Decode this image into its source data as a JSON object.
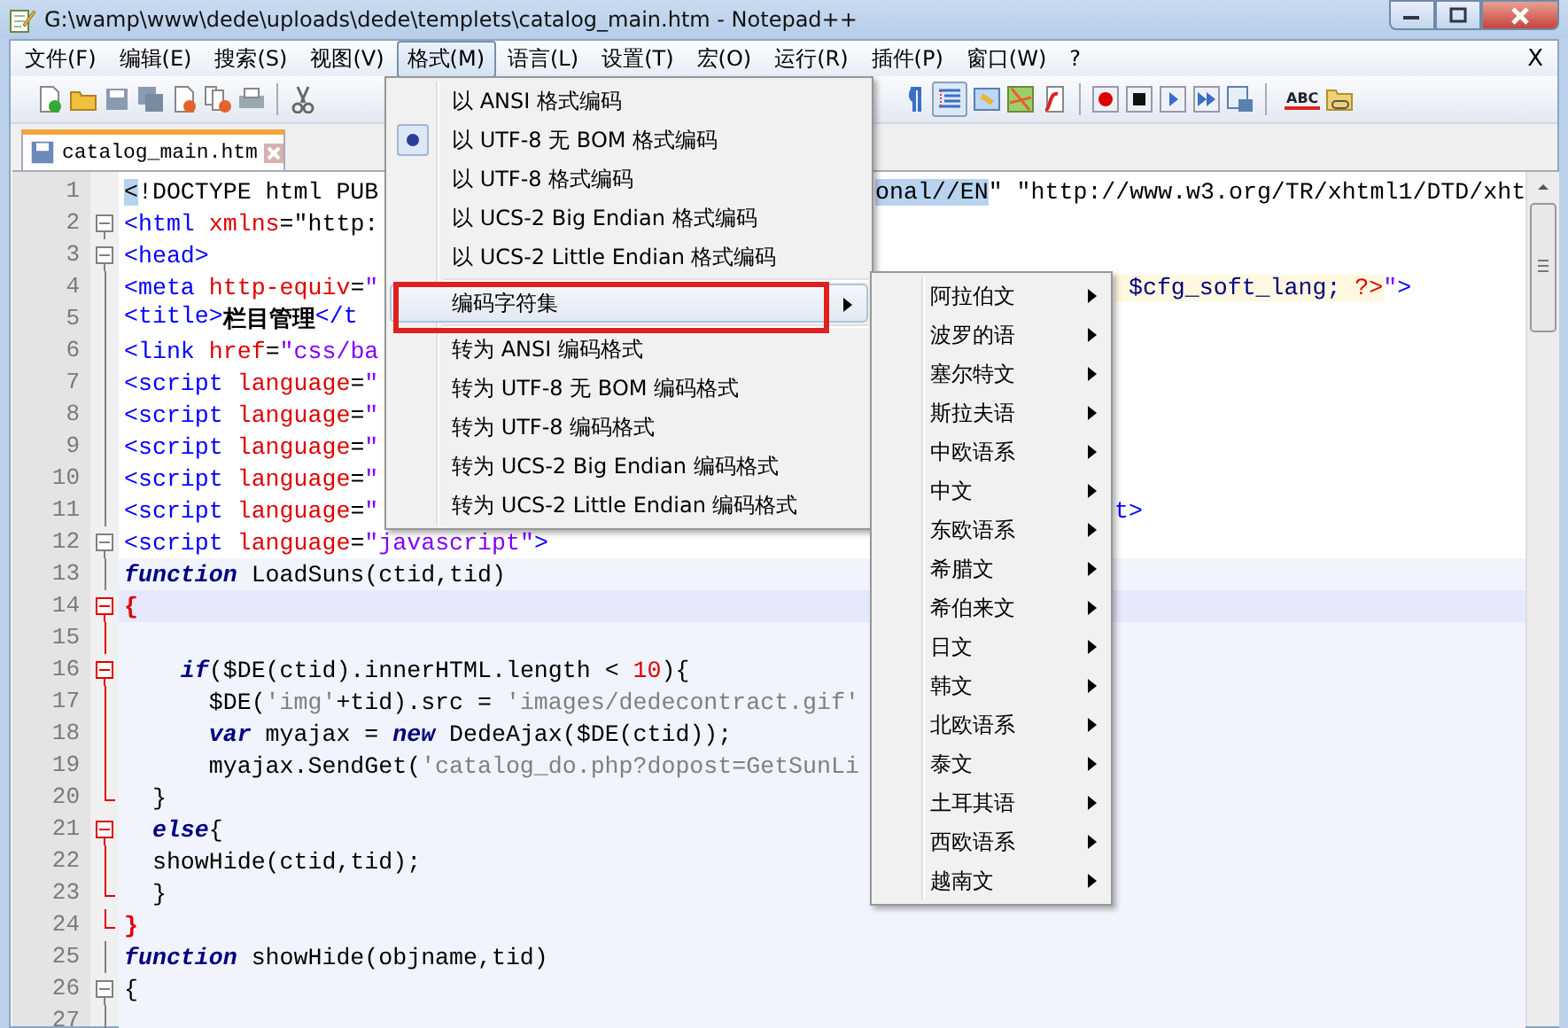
{
  "window": {
    "title": "G:\\wamp\\www\\dede\\uploads\\dede\\templets\\catalog_main.htm - Notepad++"
  },
  "menu_bar": {
    "items": [
      {
        "label": "文件(F)",
        "selected": false
      },
      {
        "label": "编辑(E)",
        "selected": false
      },
      {
        "label": "搜索(S)",
        "selected": false
      },
      {
        "label": "视图(V)",
        "selected": false
      },
      {
        "label": "格式(M)",
        "selected": true
      },
      {
        "label": "语言(L)",
        "selected": false
      },
      {
        "label": "设置(T)",
        "selected": false
      },
      {
        "label": "宏(O)",
        "selected": false
      },
      {
        "label": "运行(R)",
        "selected": false
      },
      {
        "label": "插件(P)",
        "selected": false
      },
      {
        "label": "窗口(W)",
        "selected": false
      },
      {
        "label": "?",
        "selected": false
      }
    ],
    "close_label": "X"
  },
  "toolbar": {
    "spellcheck_label": "ABC"
  },
  "tabs": [
    {
      "label": "catalog_main.htm",
      "selected": true
    }
  ],
  "editor": {
    "lines": [
      {
        "number": "1",
        "current": false,
        "script_block": false,
        "segs": [
          {
            "kind": "sel",
            "text": "<"
          },
          {
            "kind": "plain",
            "text": "!DOCTYPE html PUB"
          }
        ],
        "right": [
          {
            "kind": "sel",
            "text": "onal//EN"
          },
          {
            "kind": "plain",
            "text": "\" \"http://www.w3.org/TR/xhtml1/DTD/xht"
          }
        ]
      },
      {
        "number": "2",
        "fold": {
          "kind": "box",
          "active": false
        },
        "current": false,
        "script_block": false,
        "segs": [
          {
            "kind": "tag",
            "text": "<html"
          },
          {
            "kind": "attr",
            "text": " xmlns"
          },
          {
            "kind": "plain",
            "text": "=\"http:"
          }
        ]
      },
      {
        "number": "3",
        "fold": {
          "kind": "box",
          "active": false
        },
        "current": false,
        "script_block": false,
        "segs": [
          {
            "kind": "tag",
            "text": "<head>"
          }
        ]
      },
      {
        "number": "4",
        "fold": {
          "kind": "line",
          "active": false
        },
        "current": false,
        "script_block": false,
        "segs": [
          {
            "kind": "tag",
            "text": "<meta"
          },
          {
            "kind": "attr",
            "text": " http-equiv"
          },
          {
            "kind": "plain",
            "text": "="
          },
          {
            "kind": "string",
            "text": "\""
          }
        ],
        "right": [
          {
            "kind": "php",
            "text": " $cfg_soft_lang; "
          },
          {
            "kind": "phpmark",
            "text": "?>"
          },
          {
            "kind": "string",
            "text": "\""
          },
          {
            "kind": "tag",
            "text": ">"
          }
        ]
      },
      {
        "number": "5",
        "fold": {
          "kind": "line",
          "active": false
        },
        "current": false,
        "script_block": false,
        "segs": [
          {
            "kind": "tag",
            "text": "<title>"
          },
          {
            "kind": "bold",
            "text": "栏目管理"
          },
          {
            "kind": "tag",
            "text": "</t"
          }
        ]
      },
      {
        "number": "6",
        "fold": {
          "kind": "line",
          "active": false
        },
        "current": false,
        "script_block": false,
        "segs": [
          {
            "kind": "tag",
            "text": "<link"
          },
          {
            "kind": "attr",
            "text": " href"
          },
          {
            "kind": "plain",
            "text": "="
          },
          {
            "kind": "string",
            "text": "\"css/ba"
          }
        ]
      },
      {
        "number": "7",
        "fold": {
          "kind": "line",
          "active": false
        },
        "current": false,
        "script_block": false,
        "segs": [
          {
            "kind": "tag",
            "text": "<script"
          },
          {
            "kind": "attr",
            "text": " language"
          },
          {
            "kind": "plain",
            "text": "="
          },
          {
            "kind": "string",
            "text": "\""
          }
        ]
      },
      {
        "number": "8",
        "fold": {
          "kind": "line",
          "active": false
        },
        "current": false,
        "script_block": false,
        "segs": [
          {
            "kind": "tag",
            "text": "<script"
          },
          {
            "kind": "attr",
            "text": " language"
          },
          {
            "kind": "plain",
            "text": "="
          },
          {
            "kind": "string",
            "text": "\""
          }
        ]
      },
      {
        "number": "9",
        "fold": {
          "kind": "line",
          "active": false
        },
        "current": false,
        "script_block": false,
        "segs": [
          {
            "kind": "tag",
            "text": "<script"
          },
          {
            "kind": "attr",
            "text": " language"
          },
          {
            "kind": "plain",
            "text": "="
          },
          {
            "kind": "string",
            "text": "\""
          }
        ]
      },
      {
        "number": "10",
        "fold": {
          "kind": "line",
          "active": false
        },
        "current": false,
        "script_block": false,
        "segs": [
          {
            "kind": "tag",
            "text": "<script"
          },
          {
            "kind": "attr",
            "text": " language"
          },
          {
            "kind": "plain",
            "text": "="
          },
          {
            "kind": "string",
            "text": "\""
          }
        ]
      },
      {
        "number": "11",
        "fold": {
          "kind": "line",
          "active": false
        },
        "current": false,
        "script_block": false,
        "segs": [
          {
            "kind": "tag",
            "text": "<script"
          },
          {
            "kind": "attr",
            "text": " language"
          },
          {
            "kind": "plain",
            "text": "="
          },
          {
            "kind": "string",
            "text": "\""
          }
        ],
        "right": [
          {
            "kind": "tag",
            "text": "t>"
          }
        ]
      },
      {
        "number": "12",
        "fold": {
          "kind": "box",
          "active": false
        },
        "current": false,
        "script_block": false,
        "segs": [
          {
            "kind": "tag",
            "text": "<script"
          },
          {
            "kind": "attr",
            "text": " language"
          },
          {
            "kind": "plain",
            "text": "="
          },
          {
            "kind": "string",
            "text": "\"javascript\""
          },
          {
            "kind": "tag",
            "text": ">"
          }
        ]
      },
      {
        "number": "13",
        "fold": {
          "kind": "line",
          "active": false
        },
        "current": false,
        "script_block": true,
        "segs": [
          {
            "kind": "keyword",
            "text": "function"
          },
          {
            "kind": "plain",
            "text": " LoadSuns(ctid,tid)"
          }
        ]
      },
      {
        "number": "14",
        "fold": {
          "kind": "box",
          "active": true
        },
        "current": true,
        "script_block": true,
        "segs": [
          {
            "kind": "brace",
            "text": "{"
          }
        ]
      },
      {
        "number": "15",
        "fold": {
          "kind": "line",
          "active": true
        },
        "current": false,
        "script_block": true
      },
      {
        "number": "16",
        "fold": {
          "kind": "box",
          "active": true
        },
        "current": false,
        "script_block": true,
        "segs": [
          {
            "kind": "keyword",
            "text": "    if"
          },
          {
            "kind": "plain",
            "text": "($DE(ctid).innerHTML.length < "
          },
          {
            "kind": "number",
            "text": "10"
          },
          {
            "kind": "plain",
            "text": "){"
          }
        ]
      },
      {
        "number": "17",
        "fold": {
          "kind": "line",
          "active": true
        },
        "current": false,
        "script_block": true,
        "segs": [
          {
            "kind": "plain",
            "text": "      $DE("
          },
          {
            "kind": "jsstring",
            "text": "'img'"
          },
          {
            "kind": "plain",
            "text": "+tid).src = "
          },
          {
            "kind": "jsstring",
            "text": "'images/dedecontract.gif'"
          }
        ]
      },
      {
        "number": "18",
        "fold": {
          "kind": "line",
          "active": true
        },
        "current": false,
        "script_block": true,
        "segs": [
          {
            "kind": "keyword",
            "text": "      var"
          },
          {
            "kind": "plain",
            "text": " myajax = "
          },
          {
            "kind": "keyword",
            "text": "new"
          },
          {
            "kind": "plain",
            "text": " DedeAjax($DE(ctid));"
          }
        ]
      },
      {
        "number": "19",
        "fold": {
          "kind": "line",
          "active": true
        },
        "current": false,
        "script_block": true,
        "segs": [
          {
            "kind": "plain",
            "text": "      myajax.SendGet("
          },
          {
            "kind": "jsstring",
            "text": "'catalog_do.php?dopost=GetSunLi"
          }
        ]
      },
      {
        "number": "20",
        "fold": {
          "kind": "end",
          "active": true
        },
        "current": false,
        "script_block": true,
        "segs": [
          {
            "kind": "plain",
            "text": "  }"
          }
        ]
      },
      {
        "number": "21",
        "fold": {
          "kind": "box",
          "active": true
        },
        "current": false,
        "script_block": true,
        "segs": [
          {
            "kind": "keyword",
            "text": "  else"
          },
          {
            "kind": "plain",
            "text": "{"
          }
        ]
      },
      {
        "number": "22",
        "fold": {
          "kind": "line",
          "active": true
        },
        "current": false,
        "script_block": true,
        "segs": [
          {
            "kind": "plain",
            "text": "  showHide(ctid,tid);"
          }
        ]
      },
      {
        "number": "23",
        "fold": {
          "kind": "end",
          "active": true
        },
        "current": false,
        "script_block": true,
        "segs": [
          {
            "kind": "plain",
            "text": "  }"
          }
        ]
      },
      {
        "number": "24",
        "fold": {
          "kind": "end",
          "active": true
        },
        "current": false,
        "script_block": true,
        "segs": [
          {
            "kind": "brace",
            "text": "}"
          }
        ]
      },
      {
        "number": "25",
        "fold": {
          "kind": "line",
          "active": false
        },
        "current": false,
        "script_block": true,
        "segs": [
          {
            "kind": "keyword",
            "text": "function"
          },
          {
            "kind": "plain",
            "text": " showHide(objname,tid)"
          }
        ]
      },
      {
        "number": "26",
        "fold": {
          "kind": "box",
          "active": false
        },
        "current": false,
        "script_block": true,
        "segs": [
          {
            "kind": "plain",
            "text": "{"
          }
        ]
      },
      {
        "number": "27",
        "fold": {
          "kind": "line",
          "active": false
        },
        "current": false,
        "script_block": true
      }
    ]
  },
  "format_menu": {
    "items": [
      {
        "kind": "item",
        "label": "以 ANSI 格式编码",
        "checked": false,
        "selected": false
      },
      {
        "kind": "item",
        "label": "以 UTF-8 无 BOM 格式编码",
        "checked": true,
        "selected": false
      },
      {
        "kind": "item",
        "label": "以 UTF-8 格式编码",
        "checked": false,
        "selected": false
      },
      {
        "kind": "item",
        "label": "以 UCS-2 Big Endian 格式编码",
        "checked": false,
        "selected": false
      },
      {
        "kind": "item",
        "label": "以 UCS-2 Little Endian 格式编码",
        "checked": false,
        "selected": false
      },
      {
        "kind": "separator"
      },
      {
        "kind": "submenu",
        "label": "编码字符集",
        "checked": false,
        "selected": true,
        "annotated": true
      },
      {
        "kind": "separator"
      },
      {
        "kind": "item",
        "label": "转为 ANSI 编码格式",
        "checked": false,
        "selected": false
      },
      {
        "kind": "item",
        "label": "转为 UTF-8 无 BOM 编码格式",
        "checked": false,
        "selected": false
      },
      {
        "kind": "item",
        "label": "转为 UTF-8 编码格式",
        "checked": false,
        "selected": false
      },
      {
        "kind": "item",
        "label": "转为 UCS-2 Big Endian 编码格式",
        "checked": false,
        "selected": false
      },
      {
        "kind": "item",
        "label": "转为 UCS-2 Little Endian 编码格式",
        "checked": false,
        "selected": false
      }
    ]
  },
  "charset_submenu": {
    "items": [
      {
        "label": "阿拉伯文"
      },
      {
        "label": "波罗的语"
      },
      {
        "label": "塞尔特文"
      },
      {
        "label": "斯拉夫语"
      },
      {
        "label": "中欧语系"
      },
      {
        "label": "中文"
      },
      {
        "label": "东欧语系"
      },
      {
        "label": "希腊文"
      },
      {
        "label": "希伯来文"
      },
      {
        "label": "日文"
      },
      {
        "label": "韩文"
      },
      {
        "label": "北欧语系"
      },
      {
        "label": "泰文"
      },
      {
        "label": "土耳其语"
      },
      {
        "label": "西欧语系"
      },
      {
        "label": "越南文"
      }
    ]
  }
}
